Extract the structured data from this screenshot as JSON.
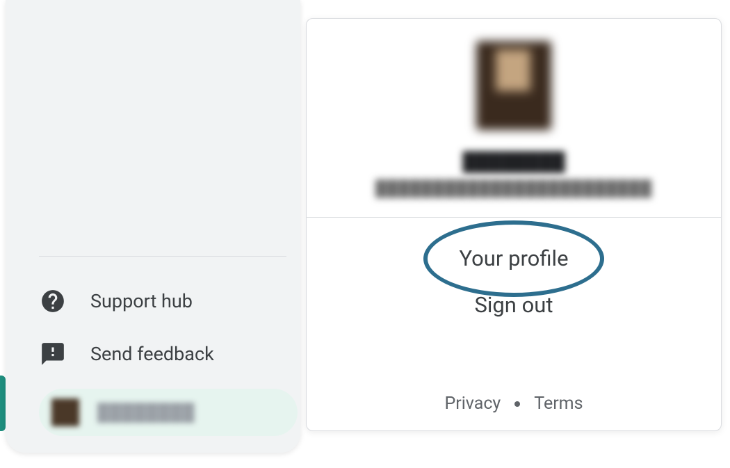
{
  "sidebar": {
    "support_label": "Support hub",
    "feedback_label": "Send feedback",
    "user_chip_label": "████████"
  },
  "profile_popover": {
    "user_name": "████████",
    "user_email": "████████████████████████",
    "your_profile_label": "Your profile",
    "sign_out_label": "Sign out",
    "privacy_label": "Privacy",
    "terms_label": "Terms"
  },
  "annotation": {
    "circled": "your-profile"
  }
}
